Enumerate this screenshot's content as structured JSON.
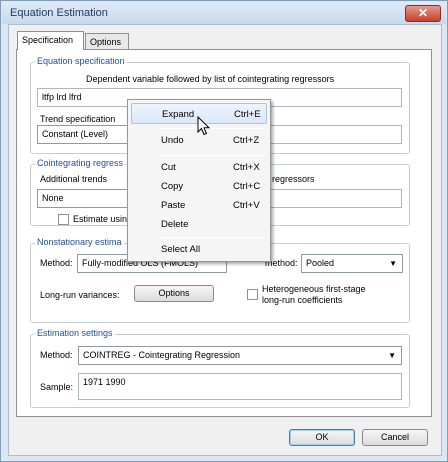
{
  "window": {
    "title": "Equation Estimation",
    "close_label": "✕"
  },
  "tabs": [
    {
      "label": "Specification"
    },
    {
      "label": "Options"
    }
  ],
  "equation_spec": {
    "group_label": "Equation specification",
    "dependent_label": "Dependent variable followed by list of cointegrating regressors",
    "dependent_value": "ltfp lrd lfrd",
    "trend_label": "Trend specification",
    "trend_value": "Constant (Level)"
  },
  "cointegrating": {
    "group_label": "Cointegrating regress",
    "additional_trends_label": "Additional trends",
    "additional_trends_value": "None",
    "regressors_label": "regressors",
    "estimate_label": "Estimate using"
  },
  "nonstationary": {
    "group_label": "Nonstationary estima",
    "method_label": "Method:",
    "method_value": "Fully-modified OLS (FMOLS)",
    "panel_method_label": "method:",
    "panel_method_value": "Pooled",
    "longrun_label": "Long-run variances:",
    "options_button": "Options",
    "heterogeneous_label_1": "Heterogeneous first-stage",
    "heterogeneous_label_2": "long-run coefficients"
  },
  "estimation": {
    "group_label": "Estimation settings",
    "method_label": "Method:",
    "method_value": "COINTREG  -  Cointegrating Regression",
    "sample_label": "Sample:",
    "sample_value": "1971 1990"
  },
  "buttons": {
    "ok": "OK",
    "cancel": "Cancel"
  },
  "context_menu": {
    "items": [
      {
        "label": "Expand",
        "shortcut": "Ctrl+E"
      },
      {
        "label": "Undo",
        "shortcut": "Ctrl+Z"
      },
      {
        "label": "Cut",
        "shortcut": "Ctrl+X"
      },
      {
        "label": "Copy",
        "shortcut": "Ctrl+C"
      },
      {
        "label": "Paste",
        "shortcut": "Ctrl+V"
      },
      {
        "label": "Delete",
        "shortcut": ""
      },
      {
        "label": "Select All",
        "shortcut": ""
      }
    ]
  }
}
